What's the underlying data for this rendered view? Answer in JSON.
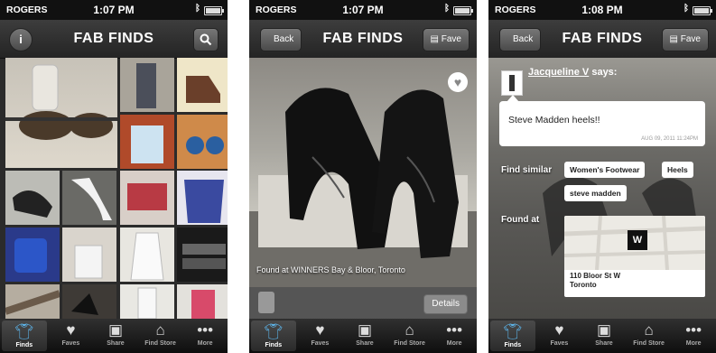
{
  "status": {
    "carrier": "ROGERS"
  },
  "screens": [
    {
      "time": "1:07 PM",
      "nav": {
        "title": "FAB FINDS",
        "left_icon": "info-icon",
        "right_icon": "search-icon"
      }
    },
    {
      "time": "1:07 PM",
      "nav": {
        "title": "FAB FINDS",
        "back_label": "Back",
        "fave_label": "Fave"
      },
      "found_at": "Found at WINNERS Bay & Bloor, Toronto",
      "details_label": "Details"
    },
    {
      "time": "1:08 PM",
      "nav": {
        "title": "FAB FINDS",
        "back_label": "Back",
        "fave_label": "Fave"
      },
      "user": "Jacqueline V",
      "says": "says:",
      "message": "Steve Madden heels!!",
      "timestamp": "AUG 09, 2011 11:24PM",
      "find_similar_label": "Find similar",
      "tags": [
        "Women's Footwear",
        "Heels",
        "steve madden"
      ],
      "found_at_label": "Found at",
      "map_marker": "W",
      "address_line1": "110 Bloor St W",
      "address_line2": "Toronto"
    }
  ],
  "tabbar": [
    {
      "label": "Finds",
      "icon": "shirt-icon"
    },
    {
      "label": "Faves",
      "icon": "heart-icon"
    },
    {
      "label": "Share",
      "icon": "camera-icon"
    },
    {
      "label": "Find Store",
      "icon": "store-icon"
    },
    {
      "label": "More",
      "icon": "more-icon"
    }
  ],
  "colors": {
    "active_tab": "#5cb3e8",
    "navbar": "#2e2e2e"
  }
}
